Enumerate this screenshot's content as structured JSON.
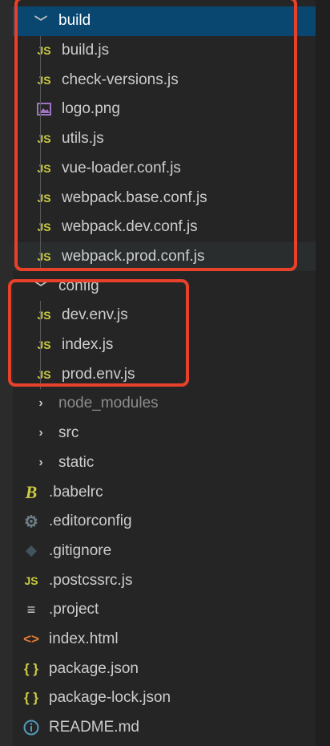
{
  "explorer": {
    "build": {
      "label": "build",
      "files": [
        {
          "label": "build.js",
          "icon": "js"
        },
        {
          "label": "check-versions.js",
          "icon": "js"
        },
        {
          "label": "logo.png",
          "icon": "image"
        },
        {
          "label": "utils.js",
          "icon": "js"
        },
        {
          "label": "vue-loader.conf.js",
          "icon": "js"
        },
        {
          "label": "webpack.base.conf.js",
          "icon": "js"
        },
        {
          "label": "webpack.dev.conf.js",
          "icon": "js"
        },
        {
          "label": "webpack.prod.conf.js",
          "icon": "js"
        }
      ]
    },
    "config": {
      "label": "config",
      "files": [
        {
          "label": "dev.env.js",
          "icon": "js"
        },
        {
          "label": "index.js",
          "icon": "js"
        },
        {
          "label": "prod.env.js",
          "icon": "js"
        }
      ]
    },
    "folders": [
      {
        "label": "node_modules"
      },
      {
        "label": "src"
      },
      {
        "label": "static"
      }
    ],
    "root_files": [
      {
        "label": ".babelrc",
        "icon": "babel"
      },
      {
        "label": ".editorconfig",
        "icon": "gear"
      },
      {
        "label": ".gitignore",
        "icon": "git"
      },
      {
        "label": ".postcssrc.js",
        "icon": "js"
      },
      {
        "label": ".project",
        "icon": "text"
      },
      {
        "label": "index.html",
        "icon": "html"
      },
      {
        "label": "package.json",
        "icon": "json"
      },
      {
        "label": "package-lock.json",
        "icon": "json"
      },
      {
        "label": "README.md",
        "icon": "info"
      }
    ],
    "js_badge": "JS",
    "json_badge": "{ }"
  },
  "colors": {
    "selection": "#094771",
    "highlight_box": "#e8412a",
    "js": "#cbcb41"
  }
}
